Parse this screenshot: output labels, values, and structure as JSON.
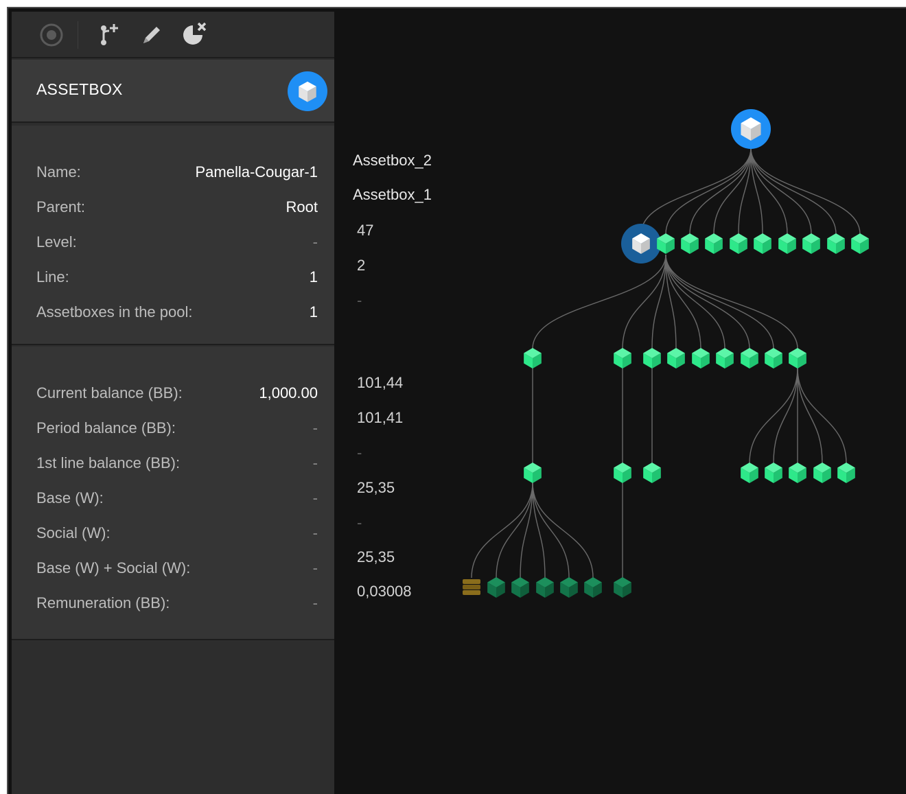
{
  "toolbar": {
    "icons": [
      "target-icon",
      "add-branch-icon",
      "pencil-icon",
      "pie-remove-icon"
    ]
  },
  "header": {
    "title": "ASSETBOX",
    "badge_icon": "cube-icon"
  },
  "info": {
    "rows": [
      {
        "label": "Name:",
        "value": "Pamella-Cougar-1",
        "compare": "Assetbox_2"
      },
      {
        "label": "Parent:",
        "value": "Root",
        "compare": "Assetbox_1"
      },
      {
        "label": "Level:",
        "value": "-",
        "compare": "47"
      },
      {
        "label": "Line:",
        "value": "1",
        "compare": "2"
      },
      {
        "label": "Assetboxes in the pool:",
        "value": "1",
        "compare": "-"
      }
    ]
  },
  "balance": {
    "rows": [
      {
        "label": "Current balance (BB):",
        "value": "1,000.00",
        "compare": "101,44"
      },
      {
        "label": "Period balance (BB):",
        "value": "-",
        "compare": "101,41"
      },
      {
        "label": "1st line balance (BB):",
        "value": "-",
        "compare": "-"
      },
      {
        "label": "Base (W):",
        "value": "-",
        "compare": "25,35"
      },
      {
        "label": "Social (W):",
        "value": "-",
        "compare": "-"
      },
      {
        "label": "Base (W) + Social (W):",
        "value": "-",
        "compare": "25,35"
      },
      {
        "label": "Remuneration (BB):",
        "value": "-",
        "compare": "0,03008"
      }
    ]
  },
  "colors": {
    "accent_blue": "#1f8ff5",
    "selected_blue": "#1a5f9a",
    "node_green": "#2ee88a",
    "node_dark_green": "#13744a",
    "node_gold": "#8a6d1c",
    "edge": "#6a6a6a"
  }
}
